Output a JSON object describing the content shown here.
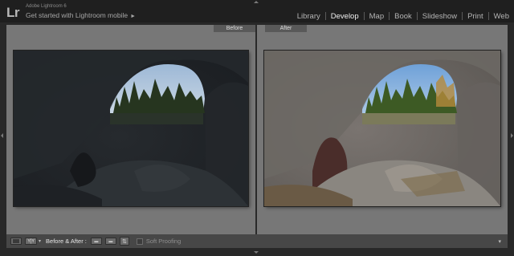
{
  "app": {
    "logo_text": "Lr",
    "name": "Adobe Lightroom 6",
    "tagline": "Get started with Lightroom mobile",
    "tagline_arrow": "►"
  },
  "modules": [
    {
      "label": "Library",
      "active": false
    },
    {
      "label": "Develop",
      "active": true
    },
    {
      "label": "Map",
      "active": false
    },
    {
      "label": "Book",
      "active": false
    },
    {
      "label": "Slideshow",
      "active": false
    },
    {
      "label": "Print",
      "active": false
    },
    {
      "label": "Web",
      "active": false
    }
  ],
  "panes": {
    "before_label": "Before",
    "after_label": "After"
  },
  "toolbar": {
    "view_mode_label": "Y|Y",
    "view_mode_caret": "▾",
    "before_after_label": "Before & After :",
    "soft_proofing_label": "Soft Proofing",
    "soft_proofing_checked": false,
    "end_caret": "▾"
  },
  "colors": {
    "background": "#282828",
    "canvas": "#777777",
    "toolbar": "#474747",
    "active_module": "#f0f0f0",
    "inactive_module": "#b4b4b4"
  },
  "icons": {
    "loupe_view": "loupe-view-icon",
    "before_after_view": "before-after-view-icon",
    "copy_before_to_after": "copy-settings-icon",
    "copy_after_to_before": "copy-settings-reverse-icon",
    "swap": "swap-icon"
  }
}
